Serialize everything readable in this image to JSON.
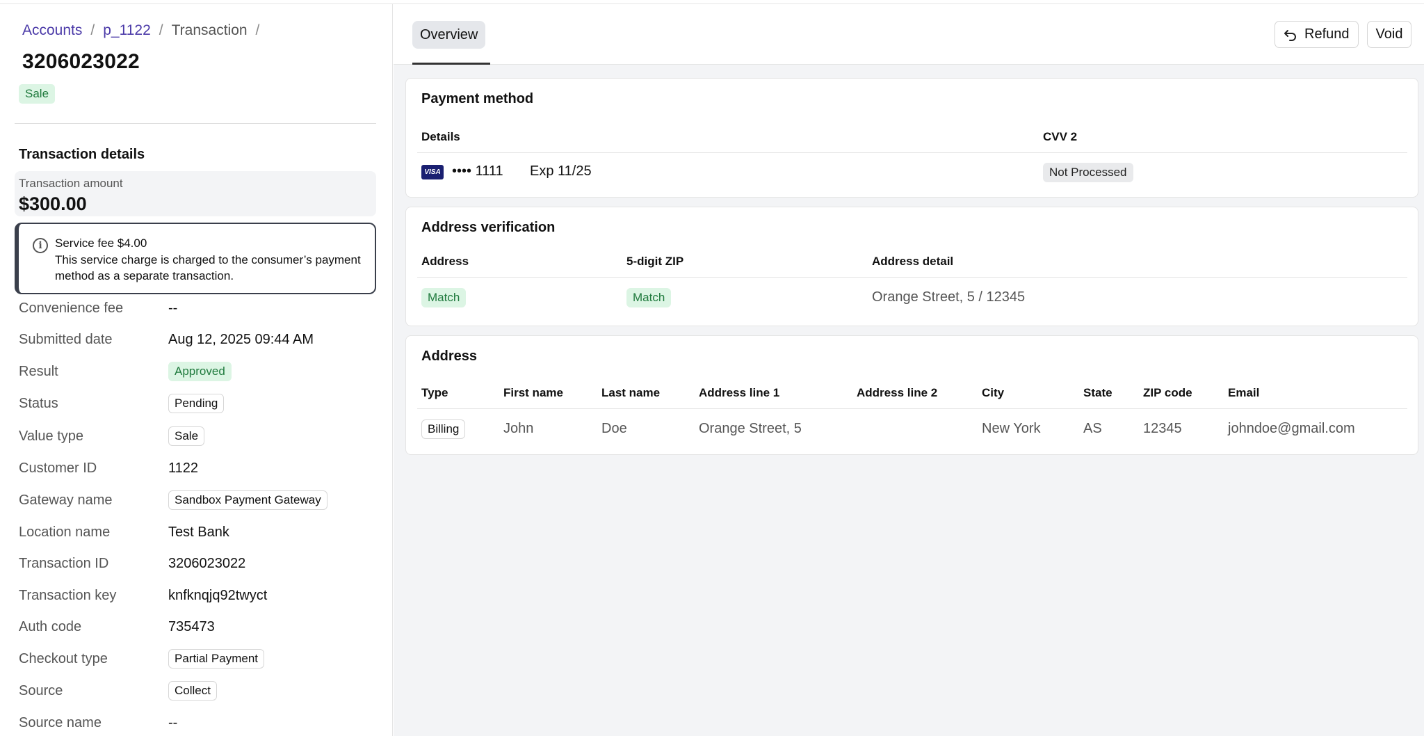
{
  "breadcrumb": {
    "items": [
      "Accounts",
      "p_1122",
      "Transaction"
    ],
    "separator": "/"
  },
  "transaction": {
    "number": "3206023022",
    "type_badge": "Sale"
  },
  "details": {
    "title": "Transaction details",
    "amount_label": "Transaction amount",
    "amount_value": "$300.00",
    "fee_notice": {
      "title": "Service fee $4.00",
      "body": "This service charge is charged to the consumer’s payment method as a separate transaction."
    },
    "rows": {
      "convenience_fee": {
        "label": "Convenience fee",
        "value": "--"
      },
      "submitted_date": {
        "label": "Submitted date",
        "value": "Aug 12, 2025 09:44 AM"
      },
      "result": {
        "label": "Result",
        "value": "Approved"
      },
      "status": {
        "label": "Status",
        "value": "Pending"
      },
      "value_type": {
        "label": "Value type",
        "value": "Sale"
      },
      "customer_id": {
        "label": "Customer ID",
        "value": "1122"
      },
      "gateway_name": {
        "label": "Gateway name",
        "value": "Sandbox Payment Gateway"
      },
      "location_name": {
        "label": "Location name",
        "value": "Test Bank"
      },
      "transaction_id": {
        "label": "Transaction ID",
        "value": "3206023022"
      },
      "transaction_key": {
        "label": "Transaction key",
        "value": "knfknqjq92twyct"
      },
      "auth_code": {
        "label": "Auth code",
        "value": "735473"
      },
      "checkout_type": {
        "label": "Checkout type",
        "value": "Partial Payment"
      },
      "source": {
        "label": "Source",
        "value": "Collect"
      },
      "source_name": {
        "label": "Source name",
        "value": "--"
      }
    }
  },
  "header": {
    "tab": "Overview",
    "refund_label": "Refund",
    "void_label": "Void"
  },
  "payment_method": {
    "title": "Payment method",
    "col_details": "Details",
    "col_cvv": "CVV 2",
    "card_brand": "VISA",
    "card_masked": "•••• 1111",
    "card_exp": "Exp 11/25",
    "cvv_status": "Not Processed"
  },
  "address_verification": {
    "title": "Address verification",
    "col_address": "Address",
    "col_zip": "5-digit ZIP",
    "col_detail": "Address detail",
    "address_result": "Match",
    "zip_result": "Match",
    "detail": "Orange Street, 5 / 12345"
  },
  "address": {
    "title": "Address",
    "columns": [
      "Type",
      "First name",
      "Last name",
      "Address line 1",
      "Address line 2",
      "City",
      "State",
      "ZIP code",
      "Email"
    ],
    "row": {
      "type": "Billing",
      "first_name": "John",
      "last_name": "Doe",
      "line1": "Orange Street, 5",
      "line2": "",
      "city": "New York",
      "state": "AS",
      "zip": "12345",
      "email": "johndoe@gmail.com"
    }
  },
  "colors": {
    "link": "#4b3aa8",
    "success_bg": "#dcf5e4",
    "success_text": "#1f7a3d",
    "panel_bg": "#f3f4f6"
  },
  "icons": {
    "info": "info-circle-icon",
    "refund": "undo-arrow-icon",
    "card": "visa-card-icon"
  }
}
